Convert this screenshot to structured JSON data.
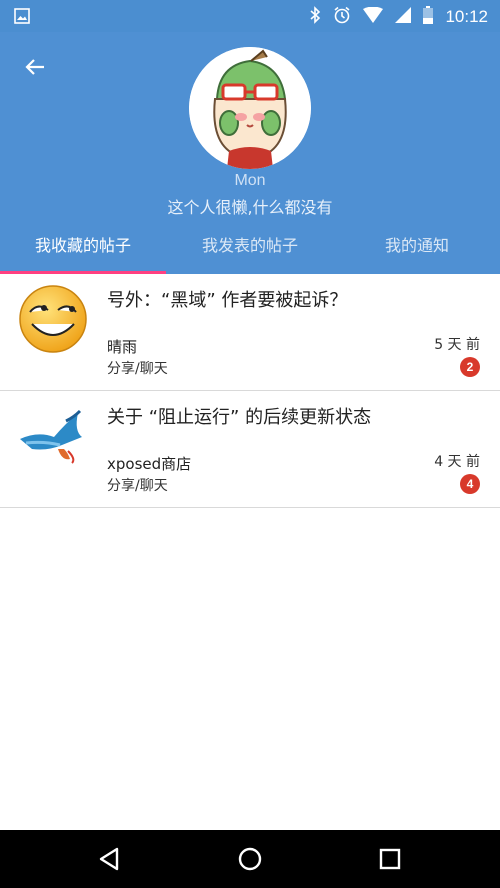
{
  "status_bar": {
    "time": "10:12",
    "icons": [
      "image-icon",
      "bluetooth-icon",
      "alarm-icon",
      "wifi-icon",
      "signal-icon",
      "battery-icon"
    ]
  },
  "profile": {
    "username": "Mon",
    "bio": "这个人很懒,什么都没有"
  },
  "tabs": [
    {
      "label": "我收藏的帖子",
      "active": true
    },
    {
      "label": "我发表的帖子",
      "active": false
    },
    {
      "label": "我的通知",
      "active": false
    }
  ],
  "posts": [
    {
      "title": "号外：“黑域” 作者要被起诉？",
      "author": "晴雨",
      "category": "分享/聊天",
      "time": "5 天 前",
      "count": "2",
      "thumb_icon": "smiley-face-icon"
    },
    {
      "title": "关于 “阻止运行” 的后续更新状态",
      "author": "xposed商店",
      "category": "分享/聊天",
      "time": "4 天 前",
      "count": "4",
      "thumb_icon": "bird-logo-icon"
    }
  ],
  "colors": {
    "header": "#4f90d3",
    "status_bar": "#4b8ed0",
    "tab_indicator": "#ff4081",
    "badge": "#d8392b"
  }
}
